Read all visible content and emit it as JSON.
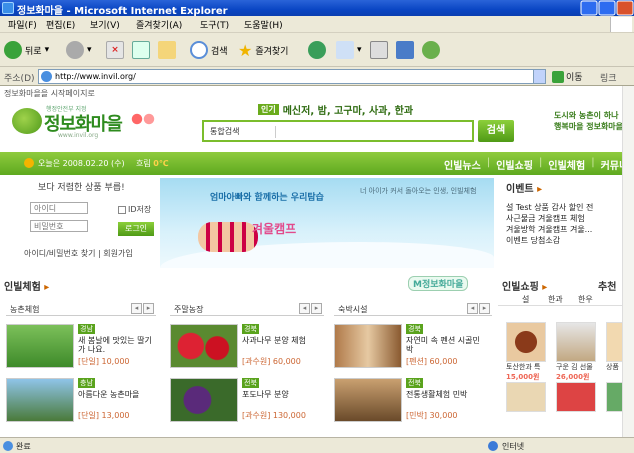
{
  "window": {
    "title": "정보화마을 - Microsoft Internet Explorer"
  },
  "menu": [
    "파일(F)",
    "편집(E)",
    "보기(V)",
    "즐겨찾기(A)",
    "도구(T)",
    "도움말(H)"
  ],
  "toolbar": {
    "back": "뒤로",
    "search": "검색",
    "favorites": "즐겨찾기"
  },
  "address": {
    "label": "주소(D)",
    "url": "http://www.invil.org/",
    "go": "이동",
    "links": "링크"
  },
  "page": {
    "notice": "정보화마을을 시작페이지로",
    "logo": {
      "sub": "행정안전부 지정",
      "main": "정보화마을",
      "url": "www.invil.org"
    },
    "popular": {
      "tag": "인기",
      "keywords": "메신저, 밤, 고구마, 사과, 한과"
    },
    "search": {
      "select": "통합검색",
      "button": "검색"
    },
    "promo": {
      "line1": "도시와 농촌이 하나",
      "line2": "행복마을 정보화마을"
    },
    "nav": {
      "date": "오늘은 2008.02.20 (수)",
      "weather": "흐림",
      "temp": "0℃",
      "items": [
        "인빌뉴스",
        "인빌쇼핑",
        "인빌체험",
        "커뮤니티"
      ]
    },
    "login": {
      "heading": "보다 저렴한 상품 부릅!",
      "id_placeholder": "아이디",
      "pw_placeholder": "비밀번호",
      "keep": "ID저장",
      "button": "로그인",
      "find": "아이디/비밀번호 찾기",
      "join": "회원가입"
    },
    "banner": {
      "title": "엄마아빠와 함께하는 우리탐습",
      "subtitle": "너 아이가 커서 돌아오는 인생, 인빌체험",
      "headline": "겨울캠프"
    },
    "events": {
      "heading": "이벤트",
      "items": [
        "설 Test 상품 감사 할인 전",
        "사근물금 겨울캠프 체험",
        "겨울방학 겨울캠프 겨울...",
        "이벤트 당첨소감"
      ]
    },
    "experience": {
      "heading": "인빌체험",
      "badge": "M정보화마을",
      "tabs": [
        "농촌체험",
        "주말농장",
        "숙박시설"
      ]
    },
    "items": [
      {
        "badge": "경남",
        "name": "새 봄날에 맛있는 딸기가 나요.",
        "price": "[단일] 10,000"
      },
      {
        "badge": "경북",
        "name": "사과나무 분양 체험",
        "price": "[과수원] 60,000"
      },
      {
        "badge": "경북",
        "name": "자연미 속 펜션 시골민박",
        "price": "[펜션] 60,000"
      },
      {
        "badge": "충남",
        "name": "아름다운 농촌마을",
        "price": "[단일] 13,000"
      },
      {
        "badge": "전북",
        "name": "포도나무 분양",
        "price": "[과수원] 130,000"
      },
      {
        "badge": "전북",
        "name": "전통생활체험 민박",
        "price": "[민박] 30,000"
      }
    ],
    "shopping": {
      "heading": "인빌쇼핑",
      "tab1": "추천",
      "tabs": [
        "설",
        "한과",
        "한우"
      ],
      "products": [
        {
          "name": "토산한과 특",
          "price": "15,000원"
        },
        {
          "name": "구운 김 선물",
          "price": "26,000원"
        },
        {
          "name": "상품",
          "price": ""
        }
      ]
    }
  },
  "status": {
    "left": "완료",
    "right": "인터넷"
  }
}
